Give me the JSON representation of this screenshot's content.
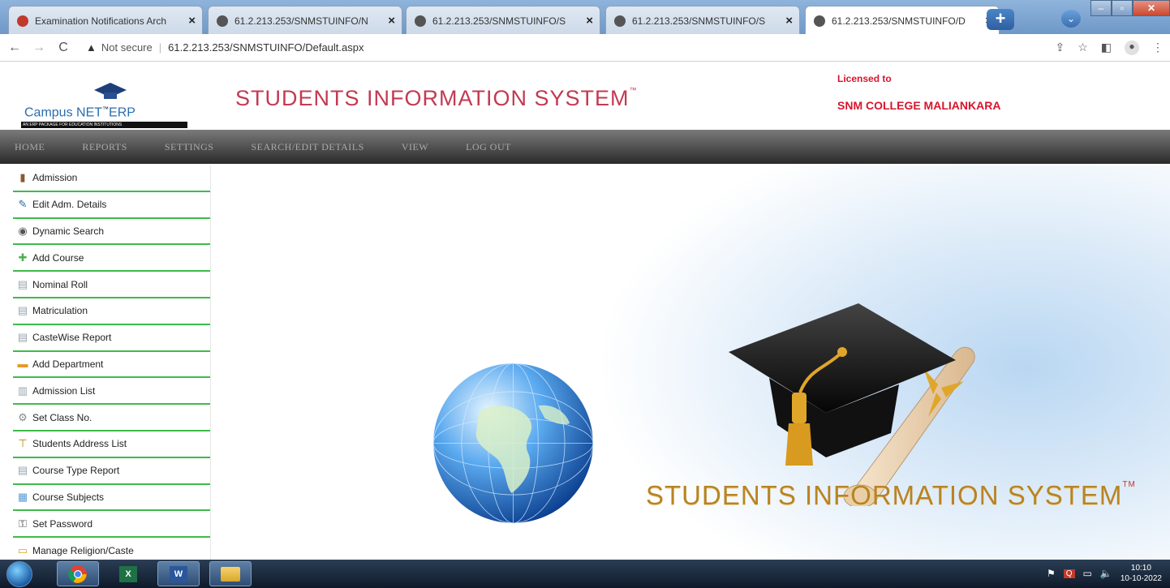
{
  "browser": {
    "tabs": [
      {
        "title": "Examination Notifications Arch",
        "icon_color": "#c0392b",
        "active": false
      },
      {
        "title": "61.2.213.253/SNMSTUINFO/N",
        "icon_color": "#555555",
        "active": false
      },
      {
        "title": "61.2.213.253/SNMSTUINFO/S",
        "icon_color": "#555555",
        "active": false
      },
      {
        "title": "61.2.213.253/SNMSTUINFO/S",
        "icon_color": "#555555",
        "active": false
      },
      {
        "title": "61.2.213.253/SNMSTUINFO/D",
        "icon_color": "#555555",
        "active": true
      }
    ],
    "security_label": "Not secure",
    "url": "61.2.213.253/SNMSTUINFO/Default.aspx"
  },
  "header": {
    "logo_text_campus": "Campus NET",
    "logo_text_tm": "™",
    "logo_text_erp": "ERP",
    "logo_tagline": "AN ERP PACKAGE FOR EDUCATION INSTITUTIONS",
    "title": "STUDENTS INFORMATION SYSTEM",
    "title_tm": "™",
    "licensed_label": "Licensed to",
    "licensee": "SNM COLLEGE MALIANKARA"
  },
  "menu": [
    "HOME",
    "REPORTS",
    "SETTINGS",
    "SEARCH/EDIT DETAILS",
    "VIEW",
    "LOG OUT"
  ],
  "sidebar": {
    "items": [
      {
        "label": "Admission",
        "icon": "door-icon"
      },
      {
        "label": "Edit Adm. Details",
        "icon": "pencil-icon"
      },
      {
        "label": "Dynamic Search",
        "icon": "binoculars-icon"
      },
      {
        "label": "Add Course",
        "icon": "plus-icon"
      },
      {
        "label": "Nominal Roll",
        "icon": "document-icon"
      },
      {
        "label": "Matriculation",
        "icon": "document-icon"
      },
      {
        "label": "CasteWise Report",
        "icon": "document-icon"
      },
      {
        "label": "Add Department",
        "icon": "folder-add-icon"
      },
      {
        "label": "Admission List",
        "icon": "list-icon"
      },
      {
        "label": "Set Class No.",
        "icon": "gear-icon"
      },
      {
        "label": "Students Address List",
        "icon": "signpost-icon"
      },
      {
        "label": "Course Type Report",
        "icon": "document-icon"
      },
      {
        "label": "Course Subjects",
        "icon": "grid-icon"
      },
      {
        "label": "Set Password",
        "icon": "key-icon"
      },
      {
        "label": "Manage Religion/Caste",
        "icon": "folder-icon"
      }
    ]
  },
  "splash": {
    "title": "STUDENTS INFORMATION SYSTEM",
    "tm": "TM"
  },
  "taskbar": {
    "time": "10:10",
    "date": "10-10-2022"
  },
  "colors": {
    "title_red": "#c33a52",
    "licensee_red": "#d8142c",
    "menu_text": "#a9a9a9",
    "sidebar_divider": "#3dbb4a",
    "splash_gold": "#b78424"
  }
}
